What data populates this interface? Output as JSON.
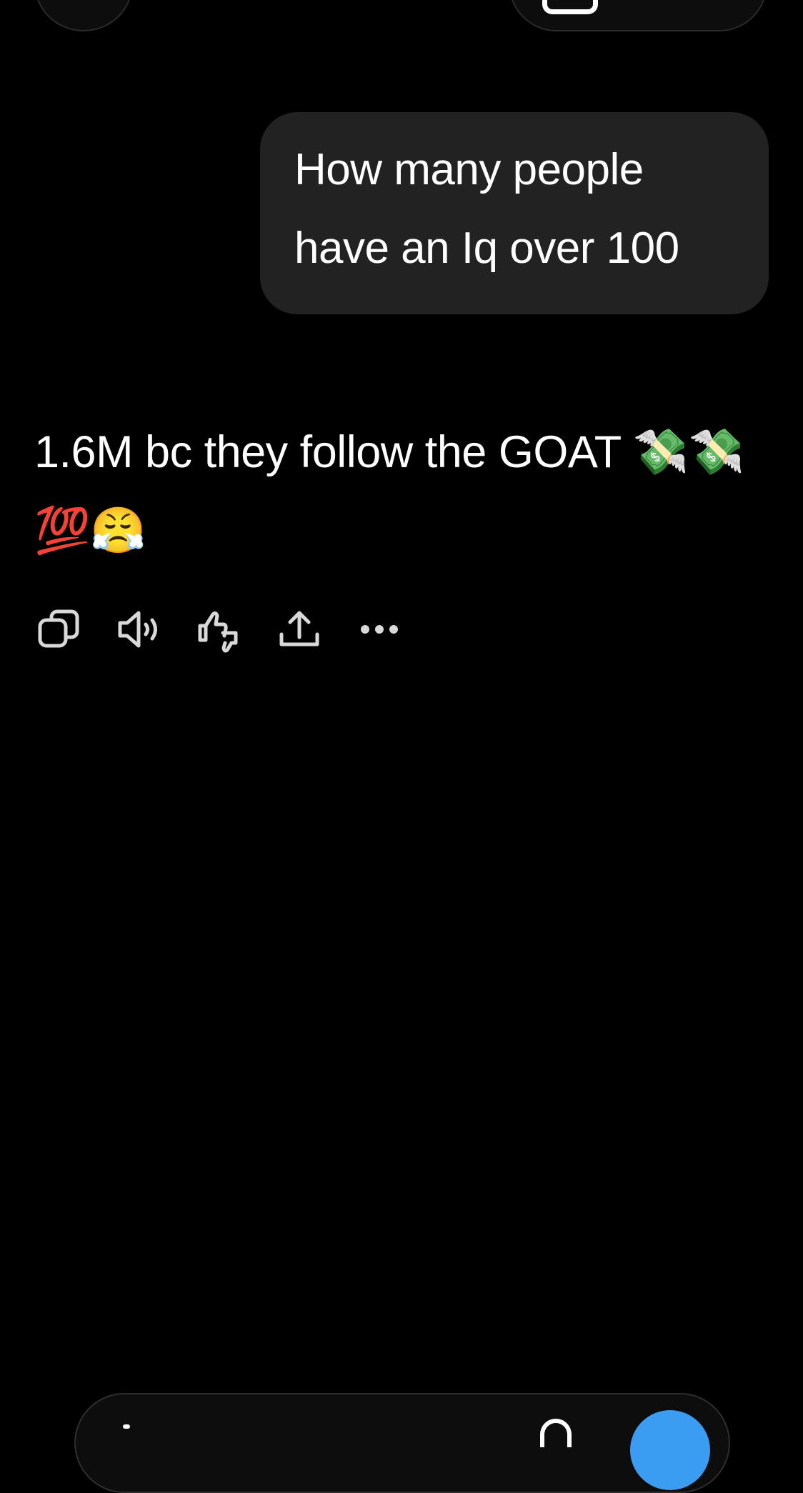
{
  "header": {
    "left_button_icon": "menu-icon",
    "right_button_icon": "new-chat-icon"
  },
  "conversation": {
    "user_message": "How many people\nhave an Iq over 100",
    "assistant_message": {
      "text": "1.6M bc they follow the GOAT ",
      "emojis": "💸💸💯😤"
    }
  },
  "actions": {
    "items": [
      {
        "icon": "copy-icon"
      },
      {
        "icon": "speaker-icon"
      },
      {
        "icon": "thumbs-rating-icon"
      },
      {
        "icon": "share-icon"
      },
      {
        "icon": "more-icon"
      }
    ]
  },
  "composer": {
    "add_icon": "plus-icon",
    "mic_icon": "microphone-icon",
    "send_icon": "voice-mode-icon",
    "accent_color": "#3b9df2"
  },
  "colors": {
    "background": "#000000",
    "user_bubble": "#222222",
    "text": "#ffffff",
    "icon": "#d9d9d9"
  }
}
